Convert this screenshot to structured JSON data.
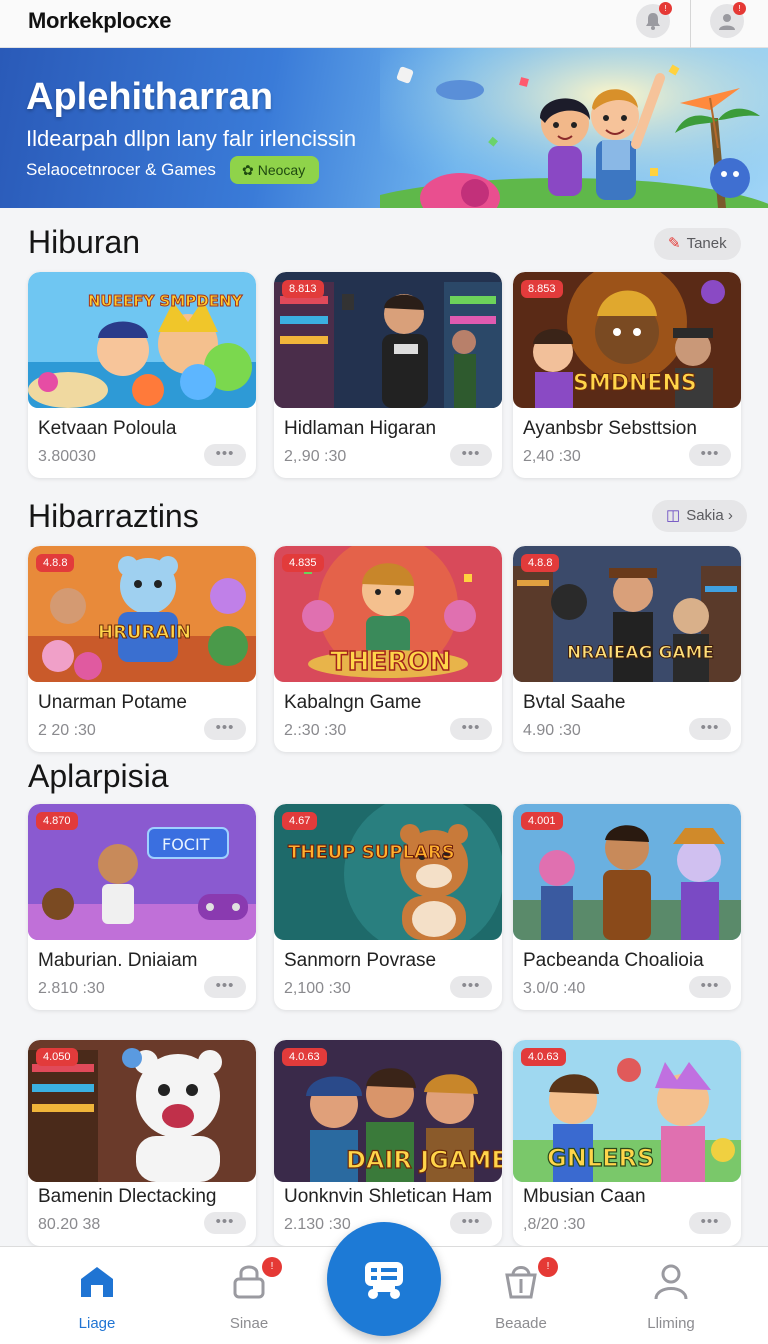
{
  "app": {
    "title": "Morkekplocxe",
    "notification_badge": "!",
    "profile_badge": "!"
  },
  "banner": {
    "title": "Aplehitharran",
    "subtitle": "Ildearpah dllpn lany falr irlencissin",
    "tagline": "Selaocetnrocer & Games",
    "chip_label": "Neocay"
  },
  "sections": [
    {
      "title": "Hiburan",
      "action_label": "Tanek",
      "action_icon": "pencil-icon",
      "cards": [
        {
          "badge": "",
          "name": "Ketvaan Poloula",
          "meta": "3.80030",
          "art_text": "NUEEFY SMPDENY"
        },
        {
          "badge": "8.813",
          "name": "Hidlaman Higaran",
          "meta": "2,.90 :30",
          "art_text": ""
        },
        {
          "badge": "8.853",
          "name": "Ayanbsbr Sebsttsion",
          "meta": "2,40 :30",
          "art_text": "SMDNENS"
        }
      ]
    },
    {
      "title": "Hibarraztins",
      "action_label": "Sakia",
      "action_icon": "book-icon",
      "cards": [
        {
          "badge": "4.8.8",
          "name": "Unarman Potame",
          "meta": "2 20 :30",
          "art_text": "HRURAIN"
        },
        {
          "badge": "4.835",
          "name": "Kabalngn Game",
          "meta": "2.:30 :30",
          "art_text": "THERON"
        },
        {
          "badge": "4.8.8",
          "name": "Bvtal Saahe",
          "meta": "4.90 :30",
          "art_text": "NRAIEAG GAME"
        }
      ]
    },
    {
      "title": "Aplarpisia",
      "action_label": "",
      "action_icon": "",
      "cards": [
        {
          "badge": "4.870",
          "name": "Maburian. Dniaiam",
          "meta": "2.810 :30",
          "art_text": "FOCIT"
        },
        {
          "badge": "4.67",
          "name": "Sanmorn Povrase",
          "meta": "2,100 :30",
          "art_text": "THEUP SUPLARS"
        },
        {
          "badge": "4.001",
          "name": "Pacbeanda Choalioia",
          "meta": "3.0/0 :40",
          "art_text": ""
        }
      ]
    },
    {
      "title": "",
      "action_label": "",
      "action_icon": "",
      "cards": [
        {
          "badge": "4.050",
          "name": "Bamenin Dlectacking",
          "meta": "80.20 38",
          "art_text": ""
        },
        {
          "badge": "4.0.63",
          "name": "Uonknvin Shletican Ham",
          "meta": "2.130 :30",
          "art_text": "DAIR JGAME"
        },
        {
          "badge": "4.0.63",
          "name": "Mbusian Caan",
          "meta": ",8/20 :30",
          "art_text": "GNLERS"
        }
      ]
    }
  ],
  "more_glyph": "•••",
  "bottom_nav": [
    {
      "label": "Liage",
      "icon": "home-icon",
      "active": true,
      "badge": ""
    },
    {
      "label": "Sinae",
      "icon": "lock-icon",
      "active": false,
      "badge": "!"
    },
    {
      "label": "",
      "icon": "gamepad-icon",
      "active": false,
      "badge": ""
    },
    {
      "label": "Beaade",
      "icon": "basket-icon",
      "active": false,
      "badge": "!"
    },
    {
      "label": "Lliming",
      "icon": "user-icon",
      "active": false,
      "badge": ""
    }
  ],
  "colors": {
    "accent": "#1d7ad6",
    "badge_red": "#e23b3b",
    "chip_green": "#8fd34a"
  }
}
